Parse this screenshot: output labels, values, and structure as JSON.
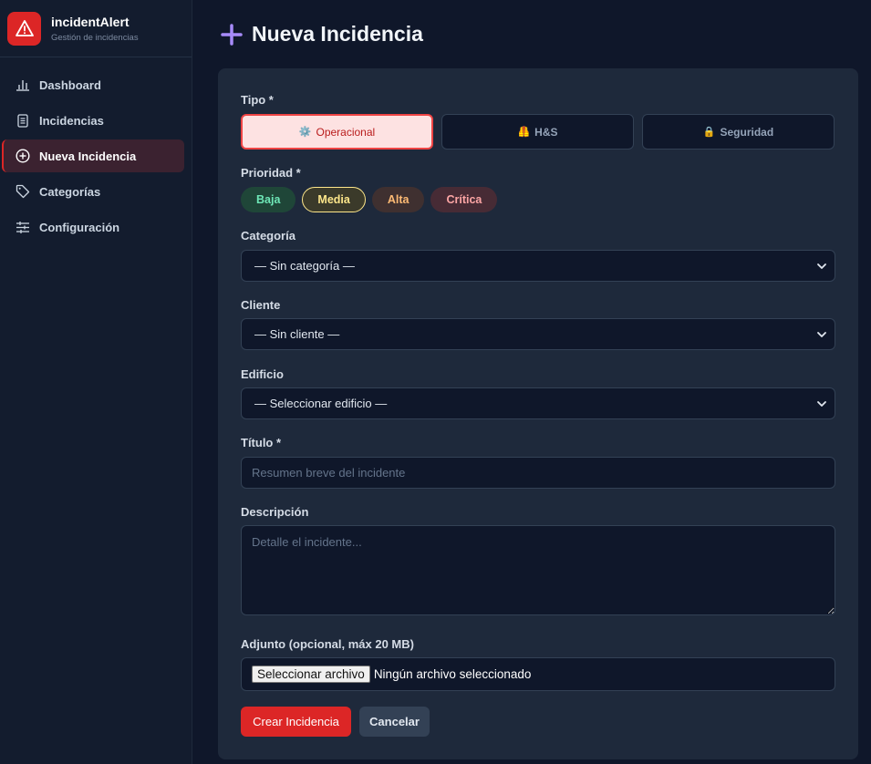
{
  "brand": {
    "name": "incidentAlert",
    "subtitle": "Gestión de incidencias"
  },
  "sidebar": {
    "items": [
      {
        "label": "Dashboard",
        "icon": "bar-chart-icon"
      },
      {
        "label": "Incidencias",
        "icon": "document-icon"
      },
      {
        "label": "Nueva Incidencia",
        "icon": "plus-circle-icon",
        "active": true
      },
      {
        "label": "Categorías",
        "icon": "tag-icon"
      },
      {
        "label": "Configuración",
        "icon": "sliders-icon"
      }
    ]
  },
  "page": {
    "title": "Nueva Incidencia"
  },
  "form": {
    "tipo": {
      "label": "Tipo *",
      "options": [
        {
          "icon": "⚙️",
          "label": "Operacional",
          "selected": true
        },
        {
          "icon": "🦺",
          "label": "H&S"
        },
        {
          "icon": "🔒",
          "label": "Seguridad"
        }
      ]
    },
    "prioridad": {
      "label": "Prioridad *",
      "options": [
        "Baja",
        "Media",
        "Alta",
        "Crítica"
      ],
      "selected": "Media"
    },
    "categoria": {
      "label": "Categoría",
      "value": "— Sin categoría —"
    },
    "cliente": {
      "label": "Cliente",
      "value": "— Sin cliente —"
    },
    "edificio": {
      "label": "Edificio",
      "value": "— Seleccionar edificio —"
    },
    "titulo": {
      "label": "Título *",
      "placeholder": "Resumen breve del incidente"
    },
    "descripcion": {
      "label": "Descripción",
      "placeholder": "Detalle el incidente..."
    },
    "adjunto": {
      "label": "Adjunto (opcional, máx 20 MB)",
      "button": "Seleccionar archivo",
      "status": "Ningún archivo seleccionado"
    },
    "submit_label": "Crear Incidencia",
    "cancel_label": "Cancelar"
  },
  "colors": {
    "accent": "#dc2626",
    "background": "#0f172a",
    "card": "#1e293b",
    "sidebar": "#131c2e"
  }
}
